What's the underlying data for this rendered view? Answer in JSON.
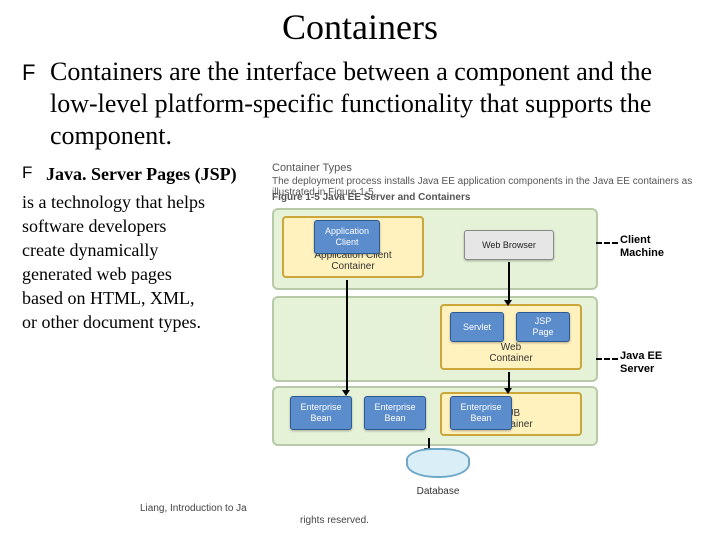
{
  "title": "Containers",
  "bullet": {
    "mark": "F",
    "text": "Containers are the interface between a component and the low-level platform-specific functionality that supports the component."
  },
  "jsp": {
    "mark": "F",
    "lead": "Java. Server Pages (JSP)",
    "body_lines": [
      "is a technology that helps",
      "software developers",
      " create dynamically",
      "generated web pages",
      "based on HTML, XML,",
      " or other document types."
    ]
  },
  "diagram": {
    "caption1": "Container Types",
    "caption2": "The deployment process installs Java EE application components in the Java EE containers as illustrated in Figure 1-5.",
    "fignum": "Figure 1-5 Java EE Server and Containers",
    "yellow": {
      "ac": "Application Client\nContainer",
      "web": "Web\nContainer",
      "ejb": "EJB\nContainer"
    },
    "tiles": {
      "appclient": "Application\nClient",
      "browser": "Web Browser",
      "servlet": "Servlet",
      "jsp": "JSP\nPage",
      "eb": "Enterprise\nBean"
    },
    "db": "Database",
    "machines": {
      "client": "Client\nMachine",
      "jee": "Java EE\nServer"
    }
  },
  "footer": {
    "left": "Liang, Introduction to Ja",
    "right": "rights reserved."
  }
}
